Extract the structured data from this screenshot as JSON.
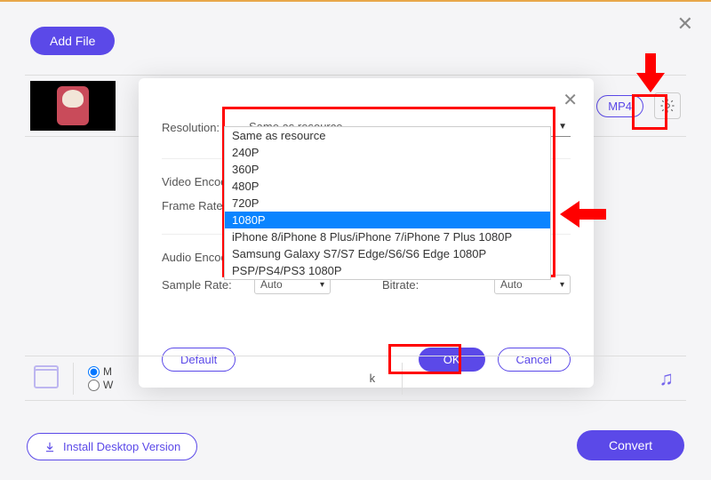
{
  "app": {
    "add_file": "Add File",
    "format_badge": "MP4"
  },
  "modal": {
    "labels": {
      "resolution": "Resolution:",
      "video_encoder": "Video Encoder:",
      "frame_rate": "Frame Rate:",
      "audio_encoder": "Audio Encoder:",
      "sample_rate": "Sample Rate:",
      "bitrate": "Bitrate:"
    },
    "resolution_selected": "Same as resource",
    "resolution_options": [
      "Same as resource",
      "240P",
      "360P",
      "480P",
      "720P",
      "1080P",
      "iPhone 8/iPhone 8 Plus/iPhone 7/iPhone 7 Plus 1080P",
      "Samsung Galaxy S7/S7 Edge/S6/S6 Edge 1080P",
      "PSP/PS4/PS3 1080P"
    ],
    "highlighted_index": 5,
    "auto": "Auto",
    "buttons": {
      "default": "Default",
      "ok": "OK",
      "cancel": "Cancel"
    }
  },
  "bottom": {
    "radio1": "M",
    "radio2": "W",
    "truncated_k": "k",
    "install": "Install Desktop Version",
    "convert": "Convert"
  }
}
